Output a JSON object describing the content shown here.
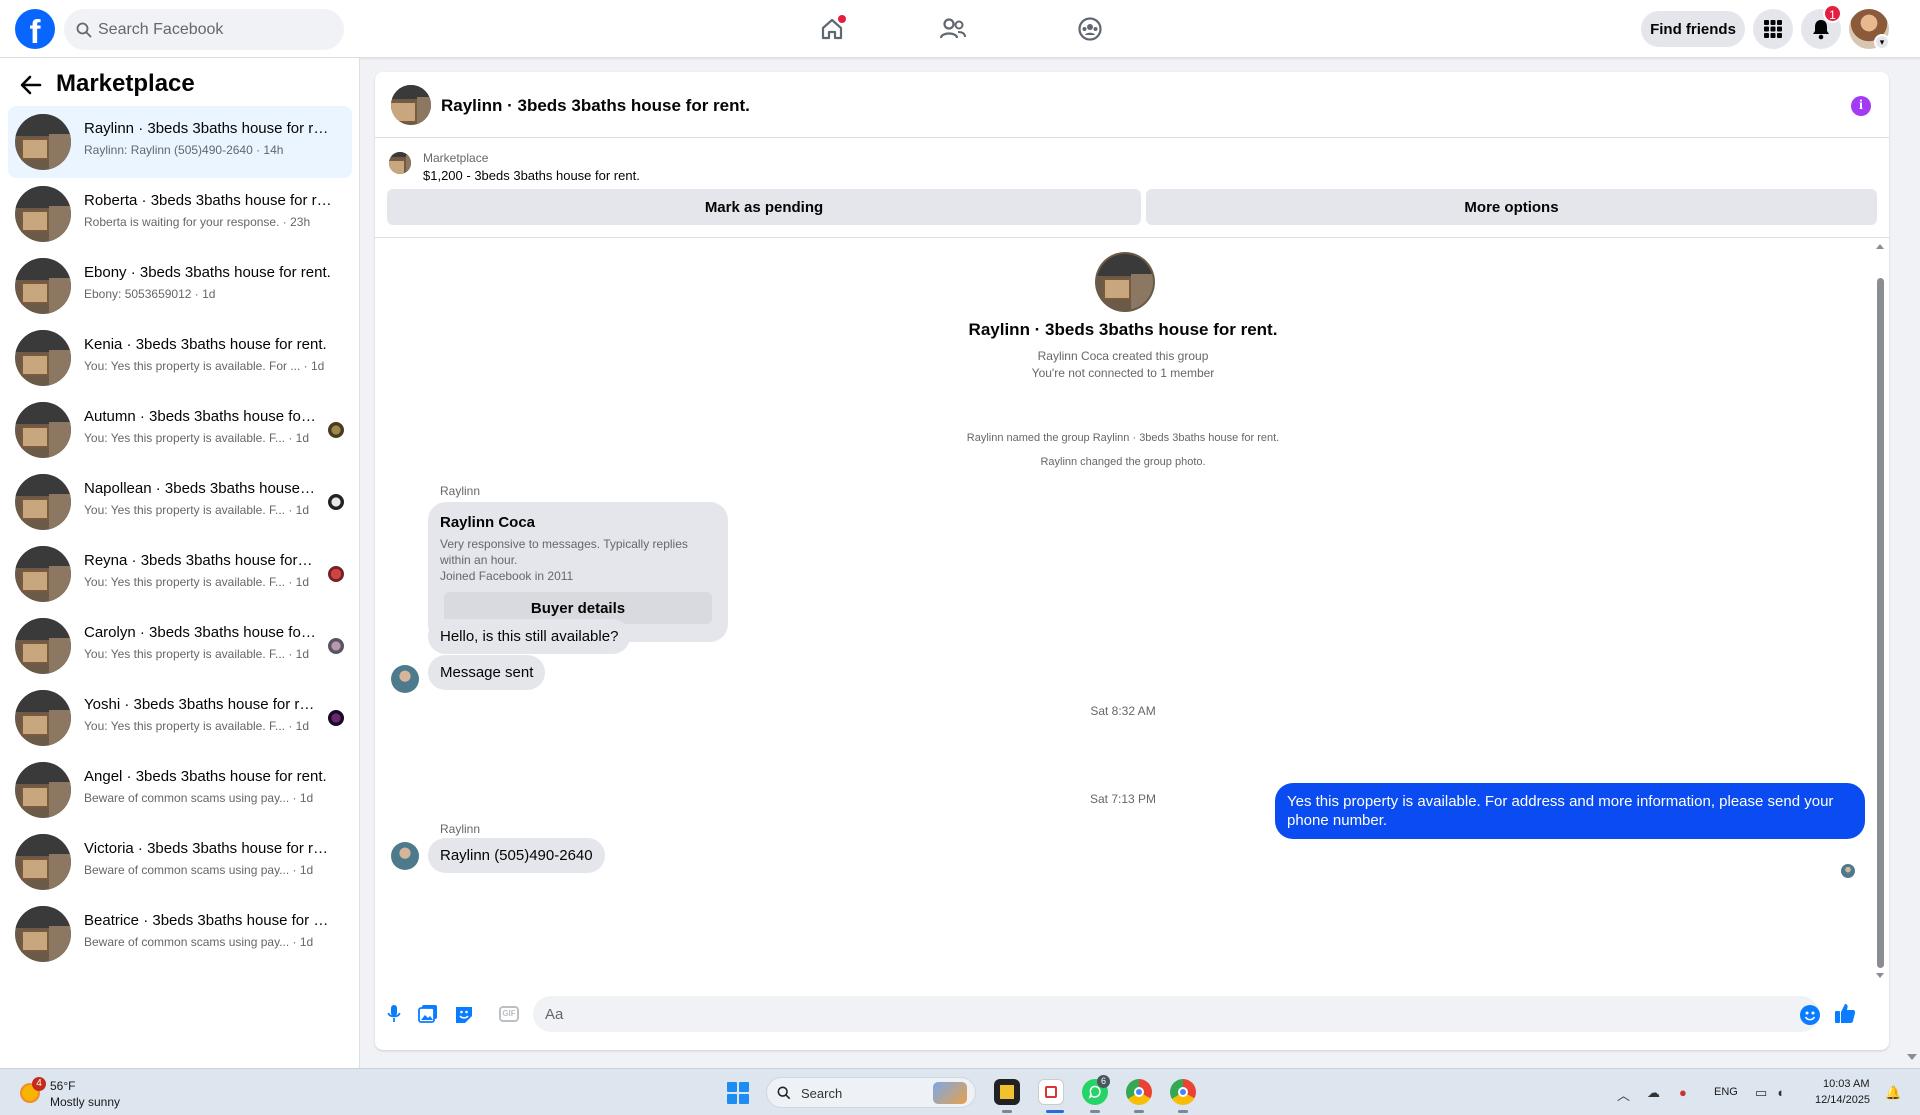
{
  "topbar": {
    "logo": "f",
    "search_placeholder": "Search Facebook",
    "find_friends_label": "Find friends",
    "notification_count": "1"
  },
  "sidebar": {
    "title": "Marketplace",
    "conversations": [
      {
        "title": "Raylinn · 3beds 3baths house for rent.",
        "subtitle": "Raylinn: Raylinn (505)490-2640 · 14h",
        "active": true
      },
      {
        "title": "Roberta · 3beds 3baths house for rent.",
        "subtitle": "Roberta is waiting for your response. · 23h"
      },
      {
        "title": "Ebony · 3beds 3baths house for rent.",
        "subtitle": "Ebony: 5053659012 · 1d"
      },
      {
        "title": "Kenia · 3beds 3baths house for rent.",
        "subtitle": "You: Yes this property is available. For ... · 1d"
      },
      {
        "title": "Autumn · 3beds 3baths house for rent.",
        "subtitle": "You: Yes this property is available. F... · 1d"
      },
      {
        "title": "Napollean · 3beds 3baths house for rent.",
        "subtitle": "You: Yes this property is available. F... · 1d"
      },
      {
        "title": "Reyna · 3beds 3baths house for rent.",
        "subtitle": "You: Yes this property is available. F... · 1d"
      },
      {
        "title": "Carolyn · 3beds 3baths house for rent.",
        "subtitle": "You: Yes this property is available. F... · 1d"
      },
      {
        "title": "Yoshi · 3beds 3baths house for rent.",
        "subtitle": "You: Yes this property is available. F... · 1d"
      },
      {
        "title": "Angel · 3beds 3baths house for rent.",
        "subtitle": "Beware of common scams using pay... · 1d"
      },
      {
        "title": "Victoria · 3beds 3baths house for rent.",
        "subtitle": "Beware of common scams using pay... · 1d"
      },
      {
        "title": "Beatrice · 3beds 3baths house for rent.",
        "subtitle": "Beware of common scams using pay... · 1d"
      }
    ]
  },
  "chat": {
    "header_title": "Raylinn · 3beds 3baths house for rent.",
    "listing_source": "Marketplace",
    "listing_price_title": "$1,200 - 3beds 3baths house for rent.",
    "mark_pending_label": "Mark as pending",
    "more_options_label": "More options",
    "group_name": "Raylinn · 3beds 3baths house for rent.",
    "created_by": "Raylinn Coca created this group",
    "connection": "You're not connected to 1 member",
    "event_named": "Raylinn named the group Raylinn · 3beds 3baths house for rent.",
    "event_photo": "Raylinn changed the group photo.",
    "sender_1": "Raylinn",
    "card_name": "Raylinn Coca",
    "card_desc_1": "Very responsive to messages. Typically replies within an hour.",
    "card_desc_2": "Joined Facebook in 2011",
    "card_button": "Buyer details",
    "msg_1": "Hello, is this still available?",
    "msg_2": "Message sent",
    "time_1": "Sat 8:32 AM",
    "out_msg": "Yes this property is available. For address and more information, please send your phone number.",
    "time_2": "Sat 7:13 PM",
    "sender_2": "Raylinn",
    "msg_3": "Raylinn (505)490-2640",
    "composer_placeholder": "Aa"
  },
  "taskbar": {
    "weather_badge": "4",
    "weather_temp": "56°F",
    "weather_condition": "Mostly sunny",
    "search_label": "Search",
    "whatsapp_badge": "6",
    "lang": "ENG",
    "time": "10:03 AM",
    "date": "12/14/2025"
  },
  "colors": {
    "brand_blue": "#0866ff",
    "outgoing_bubble": "#0a4cf2",
    "active_row": "#ebf5ff",
    "info_purple": "#a33af5"
  },
  "icons": [
    "search-icon",
    "home-icon",
    "friends-icon",
    "groups-icon",
    "apps-grid-icon",
    "bell-icon",
    "back-arrow-icon",
    "info-icon",
    "mic-icon",
    "image-icon",
    "sticker-icon",
    "gif-icon",
    "emoji-icon",
    "like-icon"
  ]
}
